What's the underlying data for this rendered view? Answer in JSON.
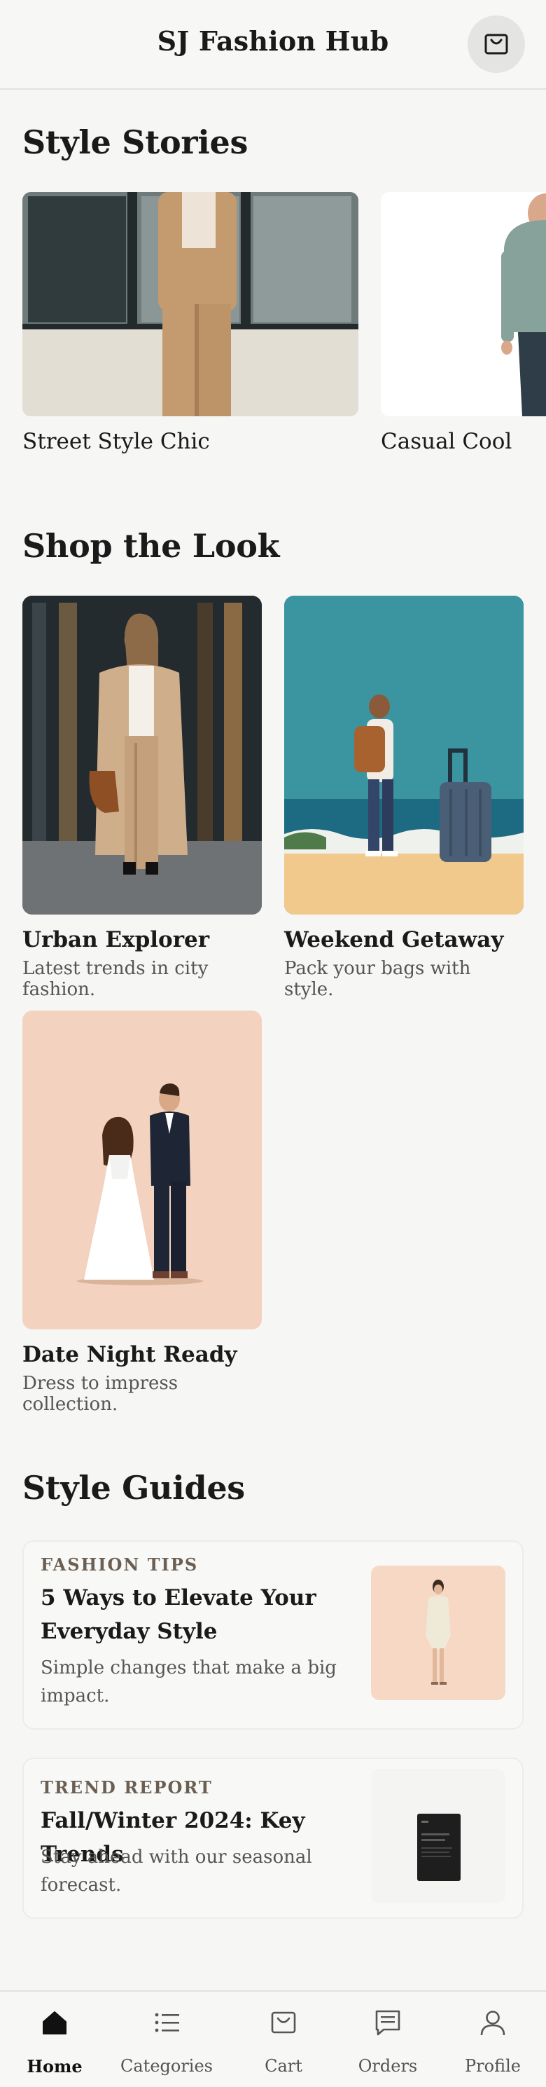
{
  "header": {
    "title": "SJ Fashion Hub",
    "cart_icon": "shopping-bag-icon"
  },
  "style_stories": {
    "title": "Style Stories",
    "items": [
      {
        "label": "Street Style Chic"
      },
      {
        "label": "Casual Cool"
      }
    ]
  },
  "shop_the_look": {
    "title": "Shop the Look",
    "items": [
      {
        "title": "Urban Explorer",
        "subtitle": "Latest trends in city fashion."
      },
      {
        "title": "Weekend Getaway",
        "subtitle": "Pack your bags with style."
      },
      {
        "title": "Date Night Ready",
        "subtitle": "Dress to impress collection."
      }
    ]
  },
  "style_guides": {
    "title": "Style Guides",
    "items": [
      {
        "tag": "FASHION TIPS",
        "title": "5 Ways to Elevate Your Everyday Style",
        "description": "Simple changes that make a big impact."
      },
      {
        "tag": "TREND REPORT",
        "title": "Fall/Winter 2024: Key Trends",
        "description": "Stay ahead with our seasonal forecast."
      }
    ]
  },
  "bottom_nav": {
    "items": [
      {
        "label": "Home",
        "icon": "home-icon",
        "active": true
      },
      {
        "label": "Categories",
        "icon": "list-icon",
        "active": false
      },
      {
        "label": "Cart",
        "icon": "shopping-bag-icon",
        "active": false
      },
      {
        "label": "Orders",
        "icon": "receipt-icon",
        "active": false
      },
      {
        "label": "Profile",
        "icon": "user-icon",
        "active": false
      }
    ]
  },
  "colors": {
    "background": "#f6f6f5",
    "text": "#1a1a1a",
    "muted_text": "#555555",
    "tag_text": "#6a5f52"
  }
}
